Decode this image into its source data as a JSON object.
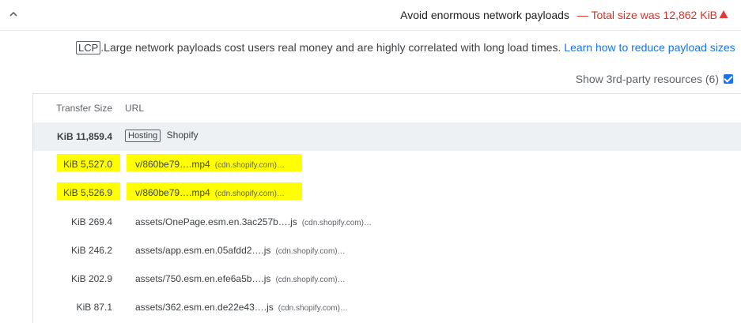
{
  "audit": {
    "title": "Avoid enormous network payloads",
    "separator": "—",
    "summary": "Total size was 12,862 KiB",
    "status_icon": "warning-triangle-icon",
    "status_color": "#d93025"
  },
  "description": {
    "badge": "LCP",
    "text": ".Large network payloads cost users real money and are highly correlated with long load times.",
    "link": "Learn how to reduce payload sizes"
  },
  "third_party": {
    "label": "Show 3rd-party resources (6)",
    "checked": true
  },
  "table": {
    "columns": [
      "Transfer Size",
      "URL"
    ],
    "group": {
      "size": "KiB 11,859.4",
      "badge": "Hosting",
      "name": "Shopify"
    },
    "rows": [
      {
        "size": "KiB 5,527.0",
        "url": "v/860be79….mp4",
        "host": "(cdn.shopify.com)…",
        "highlighted": true
      },
      {
        "size": "KiB 5,526.9",
        "url": "v/860be79….mp4",
        "host": "(cdn.shopify.com)…",
        "highlighted": true
      },
      {
        "size": "KiB 269.4",
        "url": "assets/OnePage.esm.en.3ac257b….js",
        "host": "(cdn.shopify.com)…",
        "highlighted": false
      },
      {
        "size": "KiB 246.2",
        "url": "assets/app.esm.en.05afdd2….js",
        "host": "(cdn.shopify.com)…",
        "highlighted": false
      },
      {
        "size": "KiB 202.9",
        "url": "assets/750.esm.en.efe6a5b….js",
        "host": "(cdn.shopify.com)…",
        "highlighted": false
      },
      {
        "size": "KiB 87.1",
        "url": "assets/362.esm.en.de22e43….js",
        "host": "(cdn.shopify.com)…",
        "highlighted": false
      }
    ]
  }
}
